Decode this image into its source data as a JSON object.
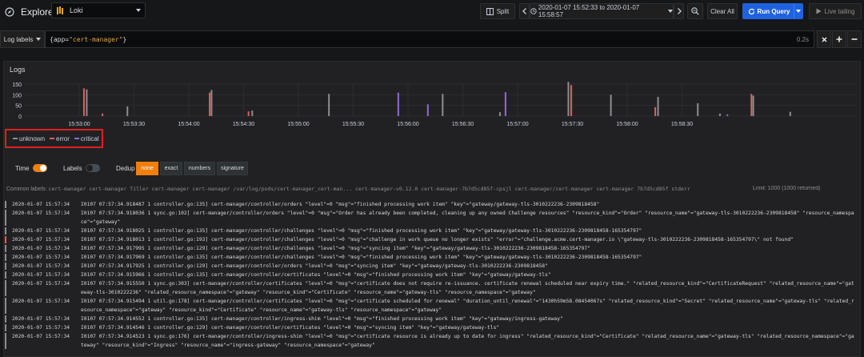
{
  "navbar": {
    "title": "Explore",
    "datasource": "Loki",
    "split_label": "Split",
    "time_range": "2020-01-07 15:52:33 to 2020-01-07 15:58:57",
    "clear_label": "Clear All",
    "run_label": "Run Query",
    "live_label": "Live tailing"
  },
  "query": {
    "log_labels_label": "Log labels",
    "brace_open": "{",
    "key": "app",
    "eq": "=",
    "value": "\"cert-manager\"",
    "brace_close": "}",
    "duration": "0.2s"
  },
  "panel": {
    "title": "Logs"
  },
  "chart_data": {
    "type": "bar",
    "yticks": [
      "150",
      "100",
      "50",
      "0"
    ],
    "ylim": [
      0,
      150
    ],
    "xticks": [
      "15:53:00",
      "15:53:30",
      "15:54:00",
      "15:54:30",
      "15:55:00",
      "15:55:30",
      "15:56:00",
      "15:56:30",
      "15:57:00",
      "15:57:30",
      "15:58:00",
      "15:58:30"
    ],
    "legend": [
      "unknown",
      "error",
      "critical"
    ],
    "colors": {
      "unknown": "#8e8e8e",
      "error": "#e05e5e",
      "critical": "#8f6ad6"
    },
    "grid": true,
    "series": [
      {
        "name": "unknown",
        "points": [
          [
            3.35,
            125
          ],
          [
            5.55,
            45
          ],
          [
            10.1,
            122
          ],
          [
            12.3,
            26
          ],
          [
            16.45,
            104
          ],
          [
            22.6,
            104
          ],
          [
            25.7,
            18
          ],
          [
            29.4,
            160
          ],
          [
            31.7,
            100
          ],
          [
            34.25,
            90
          ],
          [
            36.4,
            60
          ],
          [
            37.6,
            12
          ],
          [
            39.4,
            96
          ],
          [
            41.4,
            20
          ]
        ]
      },
      {
        "name": "error",
        "points": [
          [
            3.2,
            130
          ],
          [
            4.2,
            12
          ],
          [
            10.0,
            110
          ],
          [
            12.1,
            22
          ],
          [
            29.55,
            145
          ],
          [
            34.1,
            42
          ],
          [
            39.3,
            104
          ]
        ]
      },
      {
        "name": "critical",
        "points": [
          [
            20.2,
            110
          ],
          [
            21.8,
            55
          ],
          [
            26.0,
            112
          ],
          [
            38.0,
            8
          ]
        ]
      }
    ]
  },
  "controls": {
    "time_label": "Time",
    "labels_label": "Labels",
    "dedup_label": "Dedup",
    "dedup_options": [
      "none",
      "exact",
      "numbers",
      "signature"
    ],
    "dedup_selected": "none"
  },
  "common": {
    "title": "Common labels:",
    "values": "cert-manager  cert-manager  Tiller  cert-manager  cert-manager  /var/log/pods/cert-manager_cert-man...  cert-manager-v0.12.0  cert-manager-7b7d5cd85f-cpsjl  cert-manager/cert-manager  cert-manager  7b7d5cd85f  stderr",
    "limit": "Limit: 1000 (1000 returned)"
  },
  "logs": [
    {
      "level": "unknown",
      "color": "#8e8e8e",
      "ts": "2020-01-07 15:57:34",
      "msg": "I0107 07:57:34.918487 1 controller.go:135] cert-manager/controller/orders \"level\"=0 \"msg\"=\"finished processing work item\" \"key\"=\"gateway/gateway-tls-3010222236-2309818458\""
    },
    {
      "level": "unknown",
      "color": "#8e8e8e",
      "ts": "2020-01-07 15:57:34",
      "msg": "I0107 07:57:34.918036 1 sync.go:102] cert-manager/controller/orders \"level\"=0 \"msg\"=\"Order has already been completed, cleaning up any owned Challenge resources\" \"resource_kind\"=\"Order\" \"resource_name\"=\"gateway-tls-3010222236-2309818458\" \"resource_namespace\"=\"gateway\""
    },
    {
      "level": "unknown",
      "color": "#8e8e8e",
      "ts": "2020-01-07 15:57:34",
      "msg": "I0107 07:57:34.918025 1 controller.go:135] cert-manager/controller/challenges \"level\"=0 \"msg\"=\"finished processing work item\" \"key\"=\"gateway/gateway-tls-3010222236-2309818458-165354797\""
    },
    {
      "level": "error",
      "color": "#e05e5e",
      "ts": "2020-01-07 15:57:34",
      "msg": "I0107 07:57:34.918013 1 controller.go:193] cert-manager/controller/challenges \"level\"=0 \"msg\"=\"challenge in work queue no longer exists\" \"error\"=\"challenge.acme.cert-manager.io \\\"gateway-tls-3010222236-2309818458-165354797\\\" not found\""
    },
    {
      "level": "unknown",
      "color": "#8e8e8e",
      "ts": "2020-01-07 15:57:34",
      "msg": "I0107 07:57:34.917995 1 controller.go:129] cert-manager/controller/challenges \"level\"=0 \"msg\"=\"syncing item\" \"key\"=\"gateway/gateway-tls-3010222236-2309818458-165354797\""
    },
    {
      "level": "unknown",
      "color": "#8e8e8e",
      "ts": "2020-01-07 15:57:34",
      "msg": "I0107 07:57:34.917969 1 controller.go:135] cert-manager/controller/challenges \"level\"=0 \"msg\"=\"finished processing work item\" \"key\"=\"gateway/gateway-tls-3010222236-2309818458-165354797\""
    },
    {
      "level": "unknown",
      "color": "#8e8e8e",
      "ts": "2020-01-07 15:57:34",
      "msg": "I0107 07:57:34.917925 1 controller.go:129] cert-manager/controller/orders \"level\"=0 \"msg\"=\"syncing item\" \"key\"=\"gateway/gateway-tls-3010222236-2309818458\""
    },
    {
      "level": "unknown",
      "color": "#8e8e8e",
      "ts": "2020-01-07 15:57:34",
      "msg": "I0107 07:57:34.915966 1 controller.go:135] cert-manager/controller/certificates \"level\"=0 \"msg\"=\"finished processing work item\" \"key\"=\"gateway/gateway-tls\""
    },
    {
      "level": "unknown",
      "color": "#8e8e8e",
      "ts": "2020-01-07 15:57:34",
      "msg": "I0107 07:57:34.915550 1 sync.go:303] cert-manager/controller/certificates \"level\"=0 \"msg\"=\"certificate does not require re-issuance. certificate renewal scheduled near expiry time.\" \"related_resource_kind\"=\"CertificateRequest\" \"related_resource_name\"=\"gateway-tls-3010222236\" \"related_resource_namespace\"=\"gateway\" \"resource_kind\"=\"Certificate\" \"resource_name\"=\"gateway-tls\" \"resource_namespace\"=\"gateway\""
    },
    {
      "level": "unknown",
      "color": "#8e8e8e",
      "ts": "2020-01-07 15:57:34",
      "msg": "I0107 07:57:34.915494 1 util.go:178] cert-manager/controller/certificates \"level\"=0 \"msg\"=\"certificate scheduled for renewal\" \"duration_until_renewal\"=\"1430h59m58.08454067s\" \"related_resource_kind\"=\"Secret\" \"related_resource_name\"=\"gateway-tls\" \"related_resource_namespace\"=\"gateway\" \"resource_kind\"=\"Certificate\" \"resource_name\"=\"gateway-tls\" \"resource_namespace\"=\"gateway\""
    },
    {
      "level": "unknown",
      "color": "#8e8e8e",
      "ts": "2020-01-07 15:57:34",
      "msg": "I0107 07:57:34.914552 1 controller.go:135] cert-manager/controller/ingress-shim \"level\"=0 \"msg\"=\"finished processing work item\" \"key\"=\"gateway/ingress-gateway\""
    },
    {
      "level": "unknown",
      "color": "#8e8e8e",
      "ts": "2020-01-07 15:57:34",
      "msg": "I0107 07:57:34.914546 1 controller.go:129] cert-manager/controller/certificates \"level\"=0 \"msg\"=\"syncing item\" \"key\"=\"gateway/gateway-tls\""
    },
    {
      "level": "unknown",
      "color": "#8e8e8e",
      "ts": "2020-01-07 15:57:34",
      "msg": "I0107 07:57:34.914523 1 sync.go:176] cert-manager/controller/ingress-shim \"level\"=0 \"msg\"=\"certificate resource is already up to date for ingress\" \"related_resource_kind\"=\"Certificate\" \"related_resource_name\"=\"gateway-tls\" \"related_resource_namespace\"=\"gateway\" \"resource_kind\"=\"Ingress\" \"resource_name\"=\"ingress-gateway\" \"resource_namespace\"=\"gateway\""
    }
  ]
}
